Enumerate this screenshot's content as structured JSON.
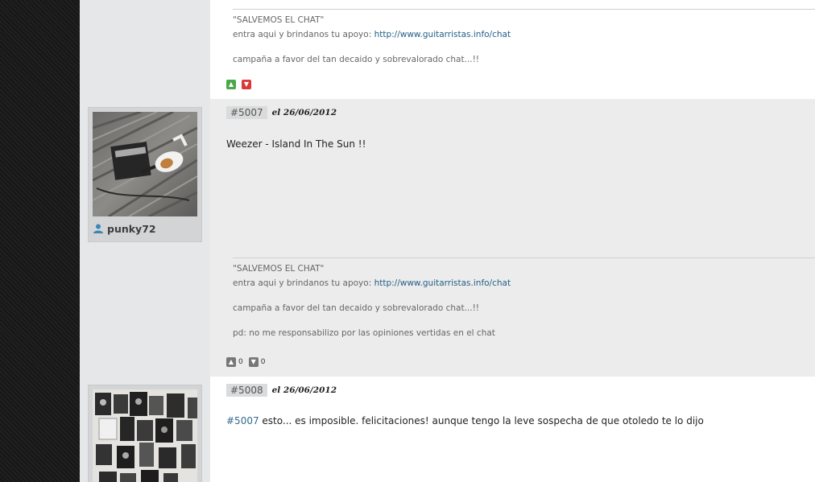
{
  "posts": [
    {
      "signature": {
        "line1": "\"SALVEMOS EL CHAT\"",
        "line2_prefix": "entra aqui y brindanos tu apoyo: ",
        "line2_link": "http://www.guitarristas.info/chat",
        "line3": "campaña a favor del tan decaido y sobrevalorado chat...!!"
      },
      "votes": {
        "up_icon": "arrow-up-icon",
        "down_icon": "arrow-down-icon",
        "up_color": "#4aa84a",
        "down_color": "#d83a3a"
      }
    },
    {
      "number": "#5007",
      "date": "el 26/06/2012",
      "username": "punky72",
      "body": "Weezer - Island In The Sun !!",
      "signature": {
        "line1": "\"SALVEMOS EL CHAT\"",
        "line2_prefix": "entra aqui y brindanos tu apoyo: ",
        "line2_link": "http://www.guitarristas.info/chat",
        "line3": "campaña a favor del tan decaido y sobrevalorado chat...!!",
        "line4": "pd: no me responsabilizo por las opiniones vertidas en el chat"
      },
      "votes": {
        "up_count": "0",
        "down_count": "0",
        "button_color": "#777777"
      }
    },
    {
      "number": "#5008",
      "date": "el 26/06/2012",
      "body_link": "#5007",
      "body_text": " esto... es imposible. felicitaciones! aunque tengo la leve sospecha de que otoledo te lo dijo"
    }
  ],
  "colors": {
    "page_bg": "#e6e7e8",
    "post_bg": "#ffffff",
    "alt_post_bg": "#ececec",
    "link": "#336b8b"
  }
}
